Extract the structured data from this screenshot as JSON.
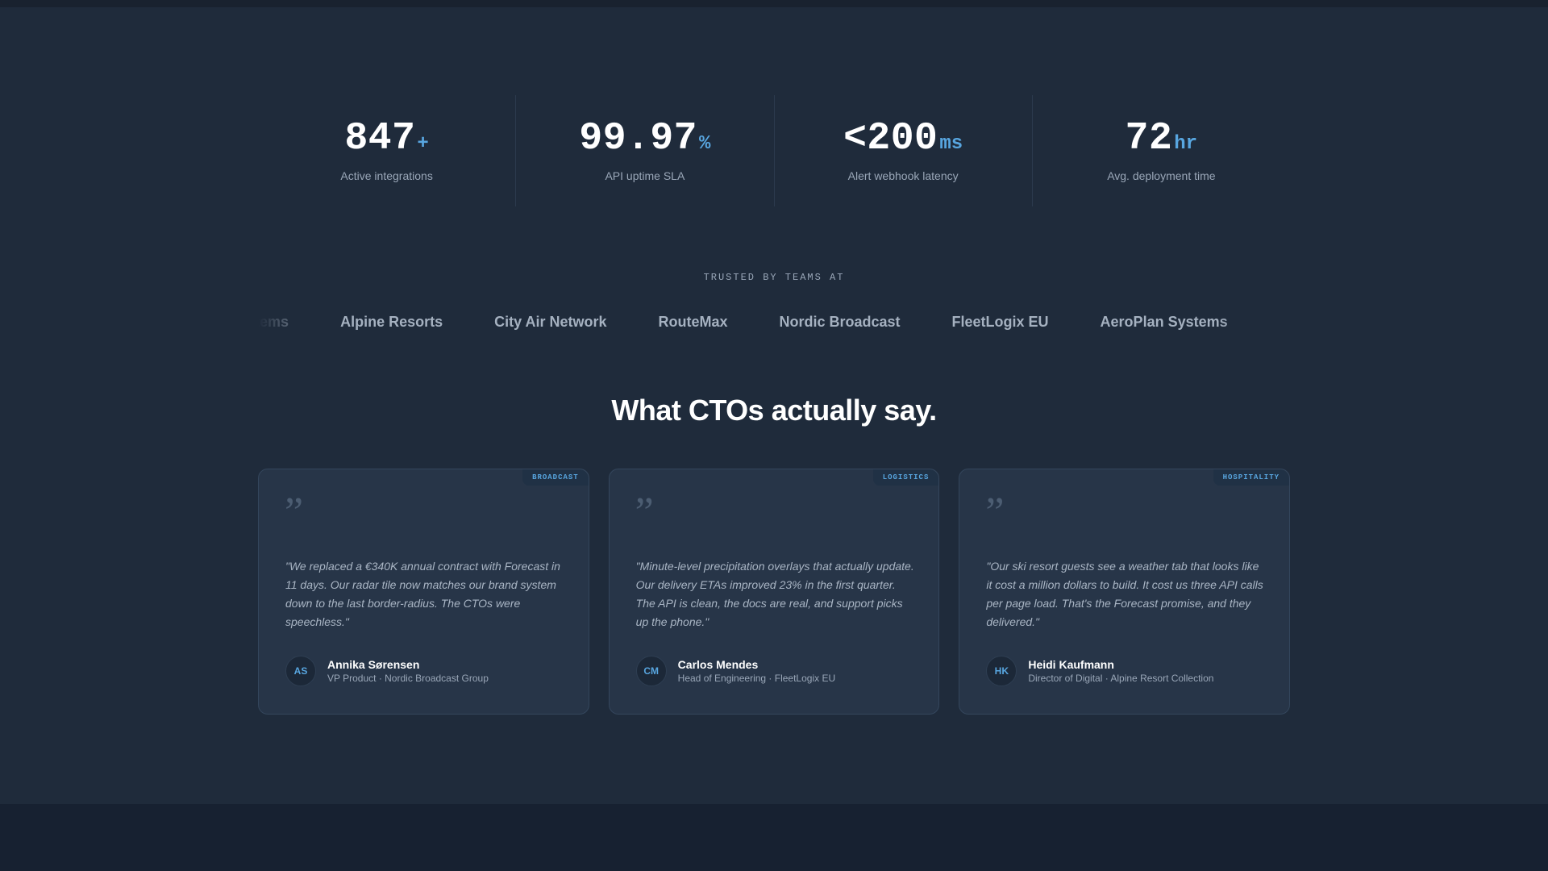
{
  "stats": [
    {
      "value": "847",
      "unit": "+",
      "label": "Active integrations"
    },
    {
      "value": "99.97",
      "unit": "%",
      "label": "API uptime SLA"
    },
    {
      "value": "<200",
      "unit": "ms",
      "label": "Alert webhook latency"
    },
    {
      "value": "72",
      "unit": "hr",
      "label": "Avg. deployment time"
    }
  ],
  "trusted": {
    "title": "TRUSTED BY TEAMS AT",
    "logos": [
      "AeroPlan Systems",
      "Alpine Resorts",
      "City Air Network",
      "RouteMax",
      "Nordic Broadcast",
      "FleetLogix EU",
      "AeroPlan Systems"
    ]
  },
  "testimonials": {
    "heading": "What CTOs actually say.",
    "cards": [
      {
        "tag": "BROADCAST",
        "quote_mark": "”",
        "quote": "\"We replaced a €340K annual contract with Forecast in 11 days. Our radar tile now matches our brand system down to the last border-radius. The CTOs were speechless.\"",
        "initials": "AS",
        "name": "Annika Sørensen",
        "role": "VP Product · Nordic Broadcast Group"
      },
      {
        "tag": "LOGISTICS",
        "quote_mark": "”",
        "quote": "\"Minute-level precipitation overlays that actually update. Our delivery ETAs improved 23% in the first quarter. The API is clean, the docs are real, and support picks up the phone.\"",
        "initials": "CM",
        "name": "Carlos Mendes",
        "role": "Head of Engineering · FleetLogix EU"
      },
      {
        "tag": "HOSPITALITY",
        "quote_mark": "”",
        "quote": "\"Our ski resort guests see a weather tab that looks like it cost a million dollars to build. It cost us three API calls per page load. That's the Forecast promise, and they delivered.\"",
        "initials": "HK",
        "name": "Heidi Kaufmann",
        "role": "Director of Digital · Alpine Resort Collection"
      }
    ]
  }
}
